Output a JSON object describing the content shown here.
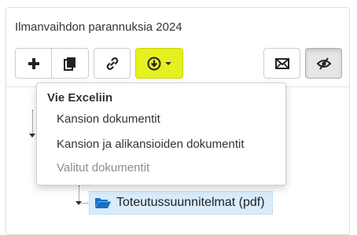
{
  "panel": {
    "title": "Ilmanvaihdon parannuksia 2024"
  },
  "toolbar": {
    "buttons": [
      {
        "name": "add-button",
        "icon": "plus-icon"
      },
      {
        "name": "copy-button",
        "icon": "copy-icon"
      },
      {
        "name": "link-button",
        "icon": "link-icon"
      },
      {
        "name": "download-button",
        "icon": "download-circle-icon",
        "highlight": "#e6f01f"
      },
      {
        "name": "email-button",
        "icon": "envelope-icon"
      },
      {
        "name": "visibility-button",
        "icon": "eye-slash-icon"
      }
    ]
  },
  "export_menu": {
    "header": "Vie Exceliin",
    "items": [
      {
        "label": "Kansion dokumentit",
        "enabled": true
      },
      {
        "label": "Kansion ja alikansioiden dokumentit",
        "enabled": true
      },
      {
        "label": "Valitut dokumentit",
        "enabled": false
      }
    ]
  },
  "tree": {
    "selected_node": {
      "label": "Toteutussuunnitelmat (pdf)",
      "icon": "folder-open-icon"
    }
  },
  "colors": {
    "highlight": "#e6f01f",
    "selected_bg": "#d9ecfb",
    "folder": "#1a6fc4"
  }
}
